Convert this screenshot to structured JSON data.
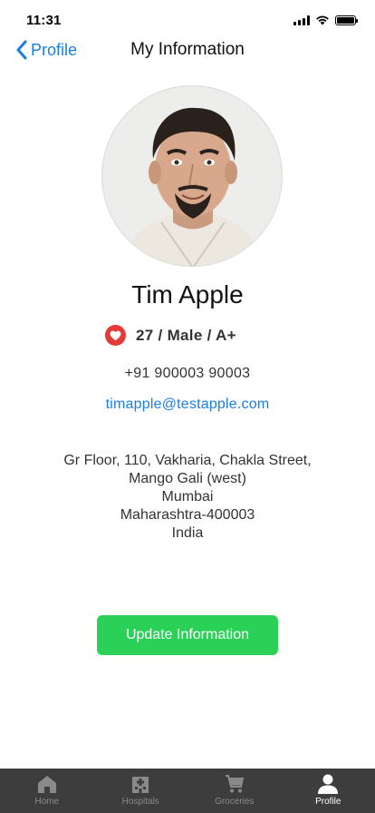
{
  "status_bar": {
    "time": "11:31"
  },
  "nav": {
    "back_label": "Profile",
    "title": "My Information"
  },
  "profile": {
    "name": "Tim Apple",
    "meta": "27 / Male / A+",
    "phone": "+91 900003 90003",
    "email": "timapple@testapple.com",
    "address": [
      "Gr Floor, 110, Vakharia, Chakla Street,",
      "Mango Gali (west)",
      "Mumbai",
      "Maharashtra-400003",
      "India"
    ]
  },
  "actions": {
    "update_label": "Update Information"
  },
  "tabs": [
    {
      "label": "Home",
      "icon": "home-icon",
      "active": false
    },
    {
      "label": "Hospitals",
      "icon": "hospital-icon",
      "active": false
    },
    {
      "label": "Groceries",
      "icon": "cart-icon",
      "active": false
    },
    {
      "label": "Profile",
      "icon": "person-icon",
      "active": true
    }
  ],
  "colors": {
    "accent_blue": "#1a7ee6",
    "button_green": "#2bd157",
    "heart_red": "#e53935",
    "tab_bar_bg": "#3d3d3d"
  }
}
